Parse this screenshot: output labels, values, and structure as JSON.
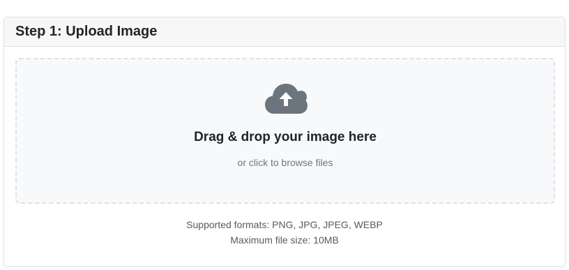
{
  "card": {
    "title": "Step 1: Upload Image"
  },
  "dropzone": {
    "icon": "cloud-upload-icon",
    "title": "Drag & drop your image here",
    "subtitle": "or click to browse files"
  },
  "info": {
    "formats": "Supported formats: PNG, JPG, JPEG, WEBP",
    "max_size": "Maximum file size: 10MB"
  },
  "colors": {
    "icon": "#6c757d",
    "dropzone_bg": "#f8f9fa",
    "dropzone_border": "#dee2e6",
    "header_bg": "#f7f7f7"
  }
}
